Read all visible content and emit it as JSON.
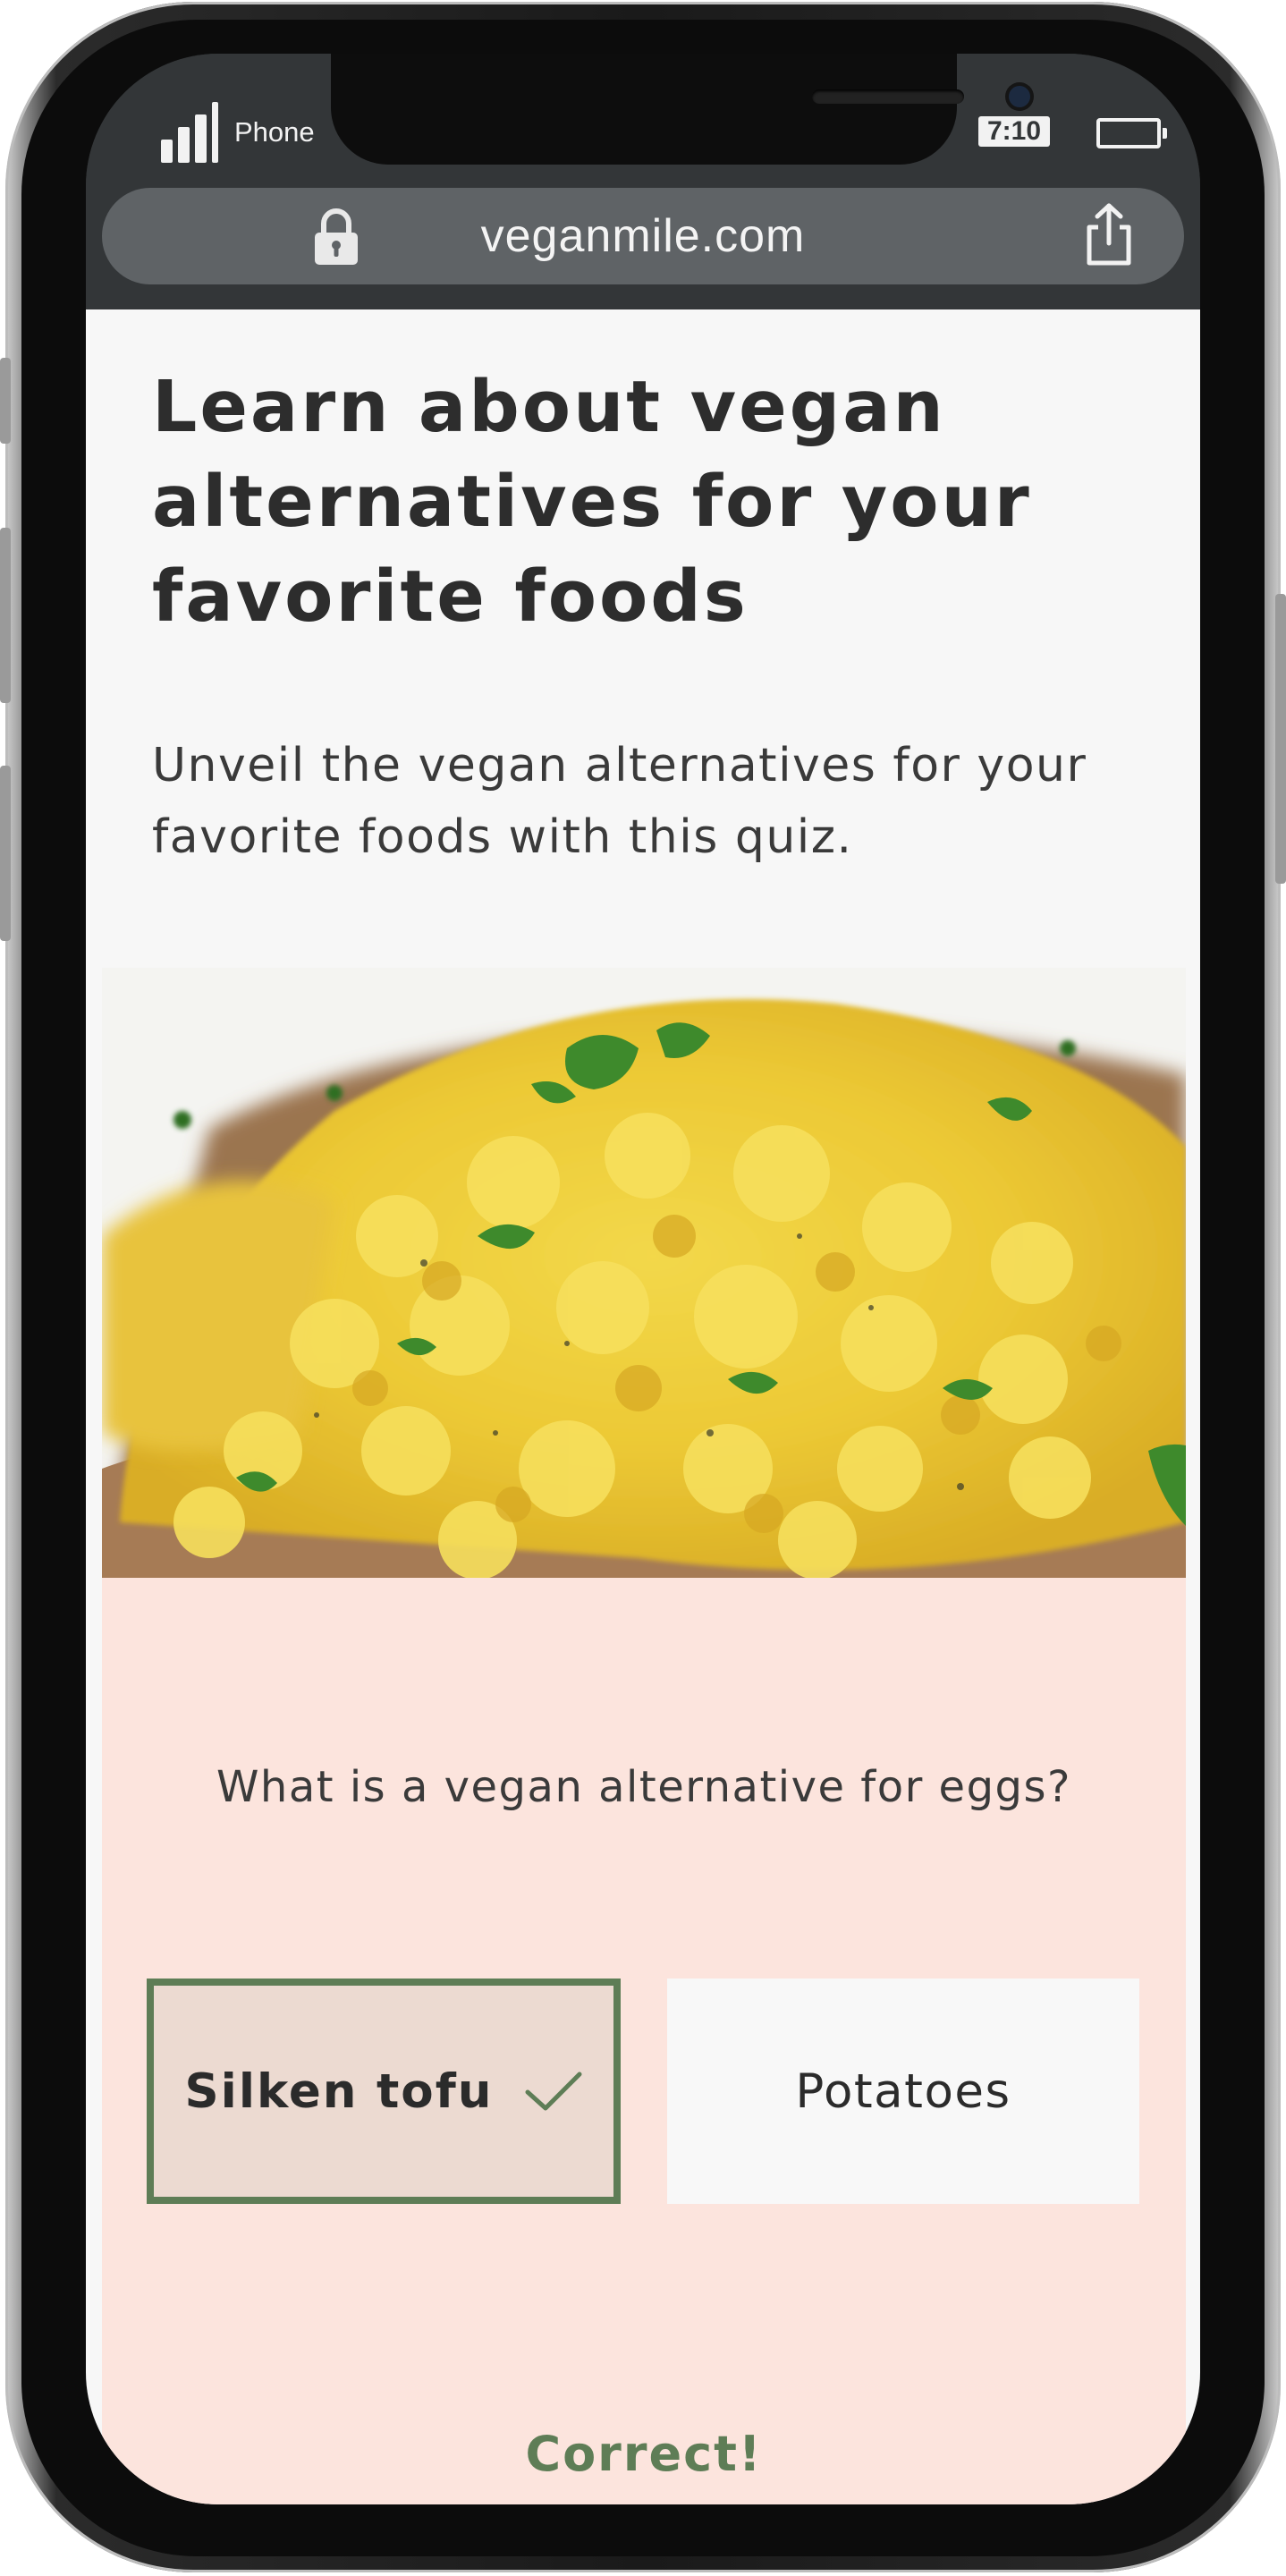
{
  "status_bar": {
    "carrier": "Phone",
    "time": "7:10"
  },
  "browser": {
    "url": "veganmile.com",
    "lock_icon": "lock-icon",
    "share_icon": "share-icon"
  },
  "content": {
    "headline": "Learn about vegan alternatives for your favorite foods",
    "subtext": "Unveil the vegan alternatives for your favorite foods with this quiz.",
    "image": "scrambled-tofu-photo"
  },
  "quiz": {
    "question": "What is a vegan alternative for eggs?",
    "answers": [
      {
        "label": "Silken tofu",
        "state": "selected-correct"
      },
      {
        "label": "Potatoes",
        "state": "unselected"
      }
    ],
    "feedback": "Correct!"
  },
  "colors": {
    "frame_dark": "#1a1a1a",
    "browser_chrome": "#333638",
    "url_pill": "#5f6366",
    "quiz_background": "#fce4dd",
    "correct_accent": "#5e7d56",
    "selected_fill": "#ecdad1",
    "text_primary": "#2d2d2d"
  }
}
